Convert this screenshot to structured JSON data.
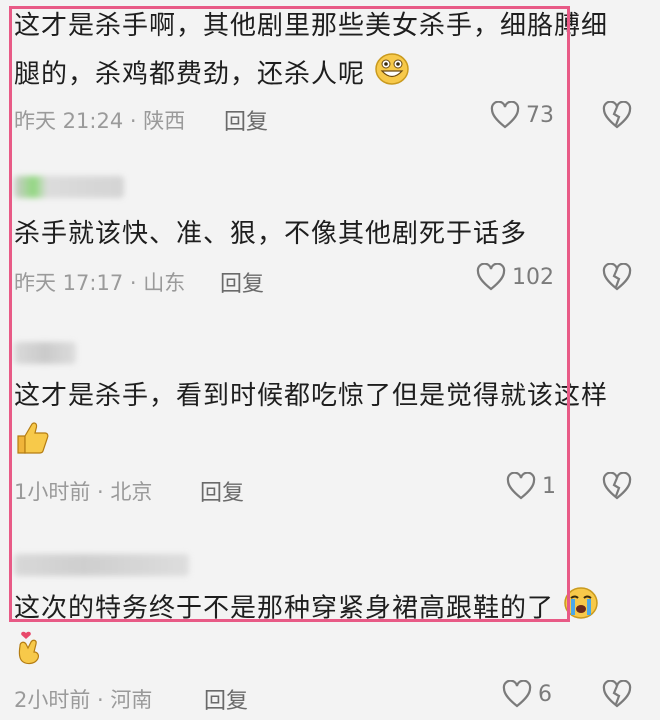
{
  "comments": [
    {
      "lines": [
        "这才是杀手啊，其他剧里那些美女杀手，细胳膊细",
        "腿的，杀鸡都费劲，还杀人呢"
      ],
      "emoji": "grinning-face-icon",
      "time": "昨天 21:24",
      "region": "陕西",
      "reply": "回复",
      "likes": "73"
    },
    {
      "lines": [
        "杀手就该快、准、狠，不像其他剧死于话多"
      ],
      "time": "昨天 17:17",
      "region": "山东",
      "reply": "回复",
      "likes": "102"
    },
    {
      "lines": [
        "这才是杀手，看到时候都吃惊了但是觉得就该这样"
      ],
      "emoji": "thumbs-up-icon",
      "time": "1小时前",
      "region": "北京",
      "reply": "回复",
      "likes": "1"
    },
    {
      "lines": [
        "这次的特务终于不是那种穿紧身裙高跟鞋的了"
      ],
      "emoji": "crying-face-icon",
      "emoji2": "finger-heart-icon",
      "time": "2小时前",
      "region": "河南",
      "reply": "回复",
      "likes": "6"
    }
  ],
  "colors": {
    "highlight_border": "#e85a86",
    "meta_text": "#9a9a9a",
    "background": "#f3f3f3"
  }
}
